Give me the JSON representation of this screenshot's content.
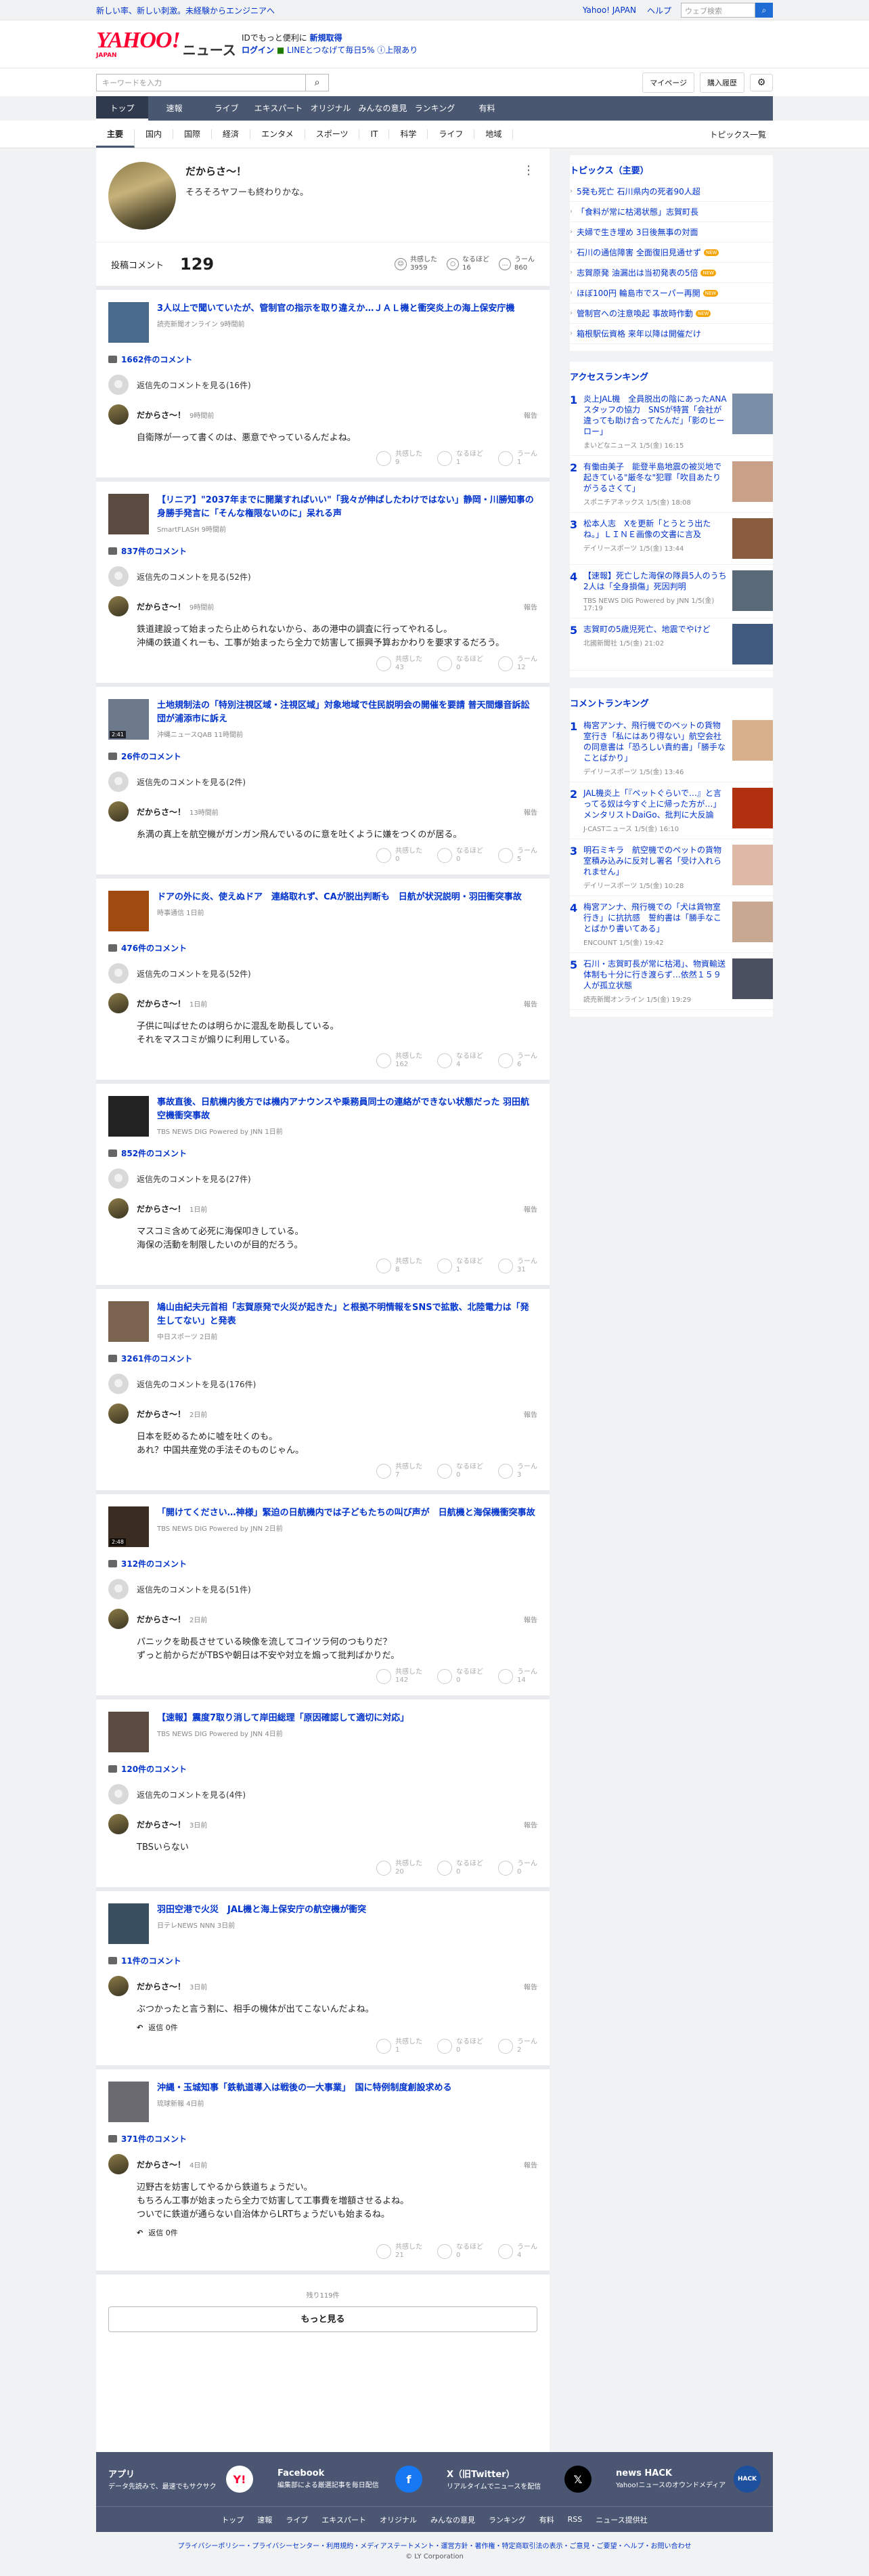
{
  "topbar": {
    "tagline": "新しい率、新しい刺激。未経験からエンジニアへ",
    "yahoo_japan": "Yahoo! JAPAN",
    "help": "ヘルプ",
    "search_placeholder": "ウェブ検索"
  },
  "header": {
    "logo_text": "YAHOO!",
    "logo_sub": "JAPAN",
    "logo_news": "ニュース",
    "promo_line1_a": "IDでもっと便利に",
    "promo_line1_b": "新規取得",
    "promo_line2_login": "ログイン",
    "promo_line2_b": "LINEとつなげて毎日5%",
    "promo_line2_c": "上限あり"
  },
  "search": {
    "placeholder": "キーワードを入力",
    "mypage": "マイページ",
    "history": "購入履歴"
  },
  "nav1": [
    "トップ",
    "速報",
    "ライブ",
    "エキスパート",
    "オリジナル",
    "みんなの意見",
    "ランキング",
    "有料"
  ],
  "nav2": [
    "主要",
    "国内",
    "国際",
    "経済",
    "エンタメ",
    "スポーツ",
    "IT",
    "科学",
    "ライフ",
    "地域"
  ],
  "nav2_all": "トピックス一覧",
  "profile": {
    "name": "だからさ〜！",
    "bio": "そろそろヤフーも終わりかな。",
    "comment_label": "投稿コメント",
    "comment_count": "129",
    "empathy_label": "共感した",
    "empathy_count": "3959",
    "naruhodo_label": "なるほど",
    "naruhodo_count": "16",
    "uun_label": "うーん",
    "uun_count": "860"
  },
  "labels": {
    "reply_destination": "返信先のコメントを見る",
    "report": "報告",
    "empathy": "共感した",
    "naruhodo": "なるほど",
    "uun": "うーん",
    "reply": "返信 0件"
  },
  "cards": [
    {
      "title": "3人以上で聞いていたが、管制官の指示を取り違えか…ＪＡＬ機と衝突炎上の海上保安庁機",
      "src": "読売新聞オンライン 9時間前",
      "count": "1662件のコメント",
      "reply_count": "(16件)",
      "time": "9時間前",
      "text": [
        "自衛隊が一って書くのは、悪意でやっているんだよね。"
      ],
      "r": [
        "9",
        "1",
        "1"
      ],
      "thumb": "#4a6a8c"
    },
    {
      "title": "【リニア】\"2037年までに開業すればいい\"「我々が伸ばしたわけではない」静岡・川勝知事の身勝手発言に「そんな権限ないのに」呆れる声",
      "src": "SmartFLASH 9時間前",
      "count": "837件のコメント",
      "reply_count": "(52件)",
      "time": "9時間前",
      "text": [
        "鉄道建設って始まったら止められないから、あの港中の調査に行ってやれるし。",
        "沖縄の鉄道くれーも、工事が始まったら全力で妨害して振興予算おかわりを要求するだろう。"
      ],
      "r": [
        "43",
        "0",
        "12"
      ],
      "thumb": "#5c4b40"
    },
    {
      "title": "土地規制法の「特別注視区域・注視区域」対象地域で住民説明会の開催を要請 普天間爆音訴訟団が浦添市に訴え",
      "src": "沖縄ニュースQAB 11時間前",
      "count": "26件のコメント",
      "reply_count": "(2件)",
      "time": "13時間前",
      "text": [
        "糸満の真上を航空機がガンガン飛んでいるのに意を吐くように嫌をつくのが居る。"
      ],
      "r": [
        "0",
        "0",
        "5"
      ],
      "thumb": "#6c7a8c",
      "vid": "2:41"
    },
    {
      "title": "ドアの外に炎、使えぬドア　連絡取れず、CAが脱出判断も　日航が状況説明・羽田衝突事故",
      "src": "時事通信 1日前",
      "count": "476件のコメント",
      "reply_count": "(52件)",
      "time": "1日前",
      "text": [
        "子供に叫ばせたのは明らかに混乱を助長している。",
        "それをマスコミが煽りに利用している。"
      ],
      "r": [
        "162",
        "4",
        "6"
      ],
      "thumb": "#a04a10"
    },
    {
      "title": "事故直後、日航機内後方では機内アナウンスや乗務員同士の連絡ができない状態だった 羽田航空機衝突事故",
      "src": "TBS NEWS DIG Powered by JNN 1日前",
      "count": "852件のコメント",
      "reply_count": "(27件)",
      "time": "1日前",
      "text": [
        "マスコミ含めて必死に海保叩きしている。",
        "海保の活動を制限したいのが目的だろう。"
      ],
      "r": [
        "8",
        "1",
        "31"
      ],
      "thumb": "#222"
    },
    {
      "title": "鳩山由紀夫元首相「志賀原発で火災が起きた」と根拠不明情報をSNSで拡散、北陸電力は「発生してない」と発表",
      "src": "中日スポーツ 2日前",
      "count": "3261件のコメント",
      "reply_count": "(176件)",
      "time": "2日前",
      "text": [
        "日本を貶めるために嘘を吐くのも。",
        "あれ？中国共産党の手法そのものじゃん。"
      ],
      "r": [
        "7",
        "0",
        "3"
      ],
      "thumb": "#7a6450"
    },
    {
      "title": "「開けてください…神様」緊迫の日航機内では子どもたちの叫び声が　日航機と海保機衝突事故",
      "src": "TBS NEWS DIG Powered by JNN 2日前",
      "count": "312件のコメント",
      "reply_count": "(51件)",
      "time": "2日前",
      "text": [
        "パニックを助長させている映像を流してコイツラ何のつもりだ？",
        "ずっと前からだがTBSや朝日は不安や対立を煽って批判ばかりだ。"
      ],
      "r": [
        "142",
        "0",
        "14"
      ],
      "thumb": "#3a2c20",
      "vid": "2:48"
    },
    {
      "title": "【速報】震度7取り消して岸田総理「原因確認して適切に対応」",
      "src": "TBS NEWS DIG Powered by JNN 4日前",
      "count": "120件のコメント",
      "reply_count": "(4件)",
      "time": "3日前",
      "text": [
        "TBSいらない"
      ],
      "r": [
        "20",
        "0",
        "0"
      ],
      "thumb": "#5a4a40"
    },
    {
      "title": "羽田空港で火災　JAL機と海上保安庁の航空機が衝突",
      "src": "日テレNEWS NNN 3日前",
      "count": "11件のコメント",
      "reply_count": "",
      "time": "3日前",
      "text": [
        "ぶつかったと言う割に、相手の機体が出てこないんだよね。"
      ],
      "r": [
        "1",
        "0",
        "2"
      ],
      "thumb": "#3a5060",
      "replies": true
    },
    {
      "title": "沖縄・玉城知事「鉄軌道導入は戦後の一大事業」　国に特例制度創設求める",
      "src": "琉球新報 4日前",
      "count": "371件のコメント",
      "reply_count": "",
      "time": "4日前",
      "text": [
        "辺野古を妨害してやるから鉄道ちょうだい。",
        "もちろん工事が始まったら全力で妨害して工事費を増額させるよね。",
        "ついでに鉄道が通らない自治体からLRTちょうだいも始まるね。"
      ],
      "r": [
        "21",
        "0",
        "4"
      ],
      "thumb": "#6a6a70",
      "replies": true
    }
  ],
  "more": {
    "remaining": "残り119件",
    "button": "もっと見る"
  },
  "topics": {
    "title": "トピックス（主要）",
    "items": [
      {
        "t": "5発も死亡 石川県内の死者90人超",
        "n": false
      },
      {
        "t": "「食料が常に枯渇状態」志賀町長",
        "n": false
      },
      {
        "t": "夫婦で生き埋め 3日後無事の対面",
        "n": false
      },
      {
        "t": "石川の通信障害 全面復旧見通せず",
        "n": true
      },
      {
        "t": "志賀原発 油漏出は当初発表の5倍",
        "n": true
      },
      {
        "t": "ほぼ100円 輪島市でスーパー再開",
        "n": true
      },
      {
        "t": "管制官への注意喚起 事故時作動",
        "n": true
      },
      {
        "t": "箱根駅伝資格 来年以降は開催だけ",
        "n": false
      }
    ]
  },
  "access": {
    "title": "アクセスランキング",
    "items": [
      {
        "t": "炎上JAL機　全員脱出の陰にあったANAスタッフの協力　SNSが特賞「会社が違っても助け合ってたんだ」「影のヒーロー」",
        "s": "まいどなニュース 1/5(金) 16:15",
        "c": "#7b8ea8"
      },
      {
        "t": "有働由美子　能登半島地震の被災地で起きている\"厳冬な\"犯罪「吹目あたりがうるさくて」",
        "s": "スポニチアネックス 1/5(金) 18:08",
        "c": "#c9a088"
      },
      {
        "t": "松本人志　Xを更新「とうとう出たね。」ＬＩＮＥ画像の文書に言及",
        "s": "デイリースポーツ 1/5(金) 13:44",
        "c": "#8a5c40"
      },
      {
        "t": "【速報】死亡した海保の隊員5人のうち2人は「全身損傷」死因判明",
        "s": "TBS NEWS DIG Powered by JNN 1/5(金) 17:19",
        "c": "#5a6a78"
      },
      {
        "t": "志賀町の5歳児死亡、地震でやけど",
        "s": "北國新聞社 1/5(金) 21:02",
        "c": "#405a80"
      }
    ]
  },
  "comment_rank": {
    "title": "コメントランキング",
    "items": [
      {
        "t": "梅宮アンナ、飛行機でのペットの貨物室行き「私にはあり得ない」航空会社の同意書は「恐ろしい責約書」「勝手なことばかり」",
        "s": "デイリースポーツ 1/5(金) 13:46",
        "c": "#d8b08c"
      },
      {
        "t": "JAL機炎上「『ペットぐらいで…』と言ってる奴は今すぐ上に帰った方が…」　メンタリストDaiGo、批判に大反論",
        "s": "J-CASTニュース 1/5(金) 16:10",
        "c": "#b03010"
      },
      {
        "t": "明石ミキラ　航空機でのペットの貨物室積み込みに反対し署名「受け入れられません」",
        "s": "デイリースポーツ 1/5(金) 10:28",
        "c": "#e0b8a8"
      },
      {
        "t": "梅宮アンナ、飛行機での「犬は貨物室行き」に抗抗感　誓約書は「勝手なことばかり書いてある」",
        "s": "ENCOUNT 1/5(金) 19:42",
        "c": "#c8a890"
      },
      {
        "t": "石川・志賀町長が常に枯渇」、物資輸送体制も十分に行き渡らず…依然１５９人が孤立状態",
        "s": "読売新聞オンライン 1/5(金) 19:29",
        "c": "#4a5060"
      }
    ]
  },
  "footer": {
    "app_h": "アプリ",
    "app_d": "データ先読みで、最速でもサクサク",
    "fb_h": "Facebook",
    "fb_d": "編集部による厳選記事を毎日配信",
    "x_h": "X（旧Twitter）",
    "x_d": "リアルタイムでニュースを配信",
    "hack_h": "news HACK",
    "hack_d": "Yahoo!ニュースのオウンドメディア",
    "nav": [
      "トップ",
      "速報",
      "ライブ",
      "エキスパート",
      "オリジナル",
      "みんなの意見",
      "ランキング",
      "有料",
      "RSS",
      "ニュース提供社"
    ],
    "legal": "プライバシーポリシー・プライバシーセンター・利用規約・メディアステートメント・運営方針・著作権・特定商取引法の表示・ご意見・ご要望・ヘルプ・お問い合わせ",
    "copy": "© LY Corporation"
  }
}
